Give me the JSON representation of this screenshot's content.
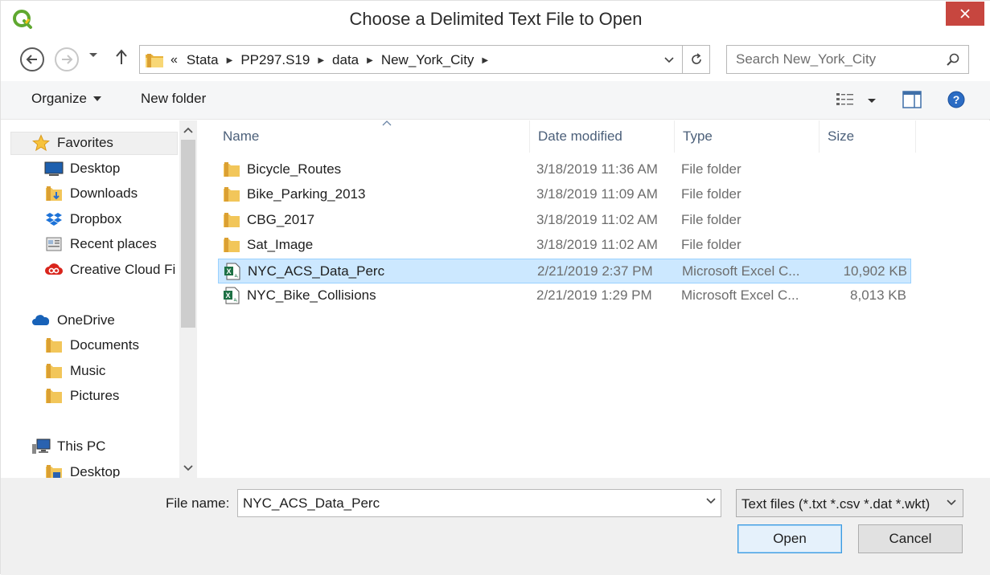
{
  "window": {
    "title": "Choose a Delimited Text File to Open",
    "app_icon": "qgis-logo-icon",
    "close_icon": "close-icon"
  },
  "navigation": {
    "back_icon": "back-arrow-icon",
    "forward_icon": "forward-arrow-icon",
    "recent_icon": "chevron-down-icon",
    "up_icon": "up-arrow-icon"
  },
  "address": {
    "lead": "«",
    "crumbs": [
      "Stata",
      "PP297.S19",
      "data",
      "New_York_City"
    ],
    "refresh_icon": "refresh-icon"
  },
  "search": {
    "placeholder": "Search New_York_City",
    "value": ""
  },
  "toolbar": {
    "organize_label": "Organize",
    "new_folder_label": "New folder",
    "view_icon": "details-view-icon",
    "preview_icon": "preview-pane-icon",
    "help_icon": "help-icon"
  },
  "sidebar": {
    "favorites": {
      "label": "Favorites",
      "items": [
        "Desktop",
        "Downloads",
        "Dropbox",
        "Recent places",
        "Creative Cloud Fi"
      ]
    },
    "onedrive": {
      "label": "OneDrive",
      "items": [
        "Documents",
        "Music",
        "Pictures"
      ]
    },
    "thispc": {
      "label": "This PC",
      "items": [
        "Desktop"
      ]
    }
  },
  "columns": {
    "name": "Name",
    "date": "Date modified",
    "type": "Type",
    "size": "Size"
  },
  "files": [
    {
      "name": "Bicycle_Routes",
      "date": "3/18/2019 11:36 AM",
      "type": "File folder",
      "size": "",
      "icon": "folder-icon"
    },
    {
      "name": "Bike_Parking_2013",
      "date": "3/18/2019 11:09 AM",
      "type": "File folder",
      "size": "",
      "icon": "folder-icon"
    },
    {
      "name": "CBG_2017",
      "date": "3/18/2019 11:02 AM",
      "type": "File folder",
      "size": "",
      "icon": "folder-icon"
    },
    {
      "name": "Sat_Image",
      "date": "3/18/2019 11:02 AM",
      "type": "File folder",
      "size": "",
      "icon": "folder-icon"
    },
    {
      "name": "NYC_ACS_Data_Perc",
      "date": "2/21/2019 2:37 PM",
      "type": "Microsoft Excel C...",
      "size": "10,902 KB",
      "icon": "excel-csv-icon",
      "selected": true
    },
    {
      "name": "NYC_Bike_Collisions",
      "date": "2/21/2019 1:29 PM",
      "type": "Microsoft Excel C...",
      "size": "8,013 KB",
      "icon": "excel-csv-icon"
    }
  ],
  "footer": {
    "file_name_label": "File name:",
    "file_name_value": "NYC_ACS_Data_Perc",
    "filter": "Text files (*.txt *.csv *.dat *.wkt)",
    "open_label": "Open",
    "cancel_label": "Cancel"
  },
  "colors": {
    "selection_bg": "#cce8ff",
    "selection_border": "#99d1ff",
    "close_button": "#c7463f",
    "header_text": "#4c607a"
  }
}
